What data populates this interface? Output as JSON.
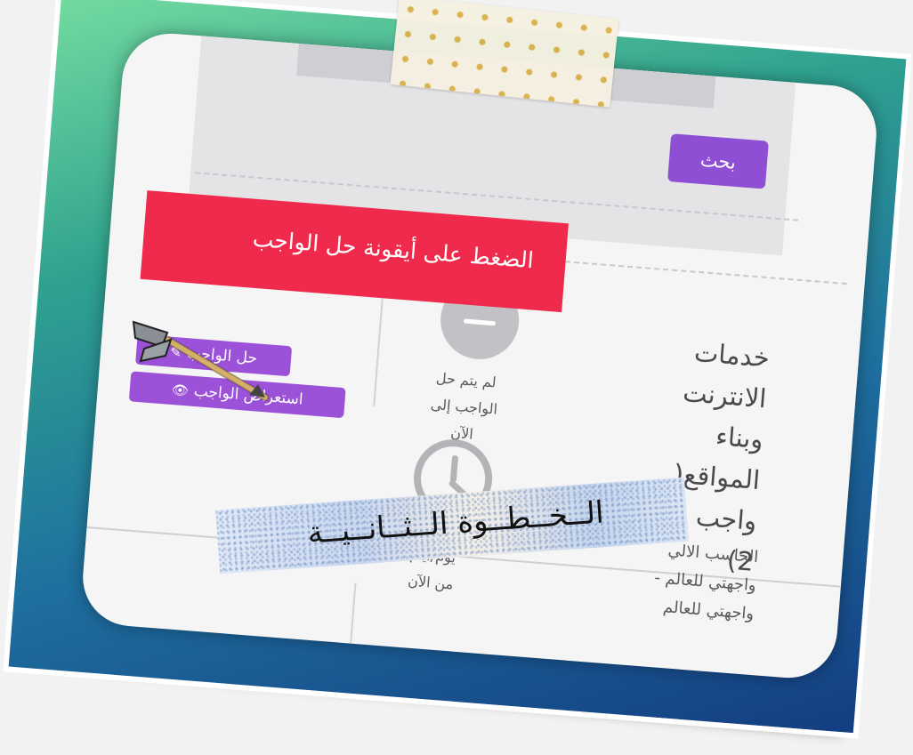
{
  "search": {
    "button_label": "بحث"
  },
  "instruction_banner": {
    "line1": "الضغط على أيقونة حل الواجب"
  },
  "assignment": {
    "title_lines": [
      "خدمات",
      "الانترنت",
      "وبناء",
      "المواقع(",
      "واجب رقم",
      "2)"
    ],
    "subtitle_lines": [
      "الحاسب الالي",
      "واجهتي للعالم -",
      "واجهتي للعالم"
    ]
  },
  "status": {
    "not_solved_lines": [
      "لم يتم حل",
      "الواجب إلى",
      "الآن"
    ],
    "remaining_lines": [
      "يوم/أيام",
      "من الآن"
    ]
  },
  "buttons": {
    "solve_label": "حل الواجب",
    "view_label": "استعراض الواجب"
  },
  "step_label": "الــخــطــوة الــثــانــيــة",
  "colors": {
    "accent_purple": "#9b52d8",
    "banner_red": "#f02a4c"
  },
  "icons": [
    "pencil-icon",
    "eye-icon",
    "minus-circle-icon",
    "clock-icon",
    "arrow-icon"
  ]
}
